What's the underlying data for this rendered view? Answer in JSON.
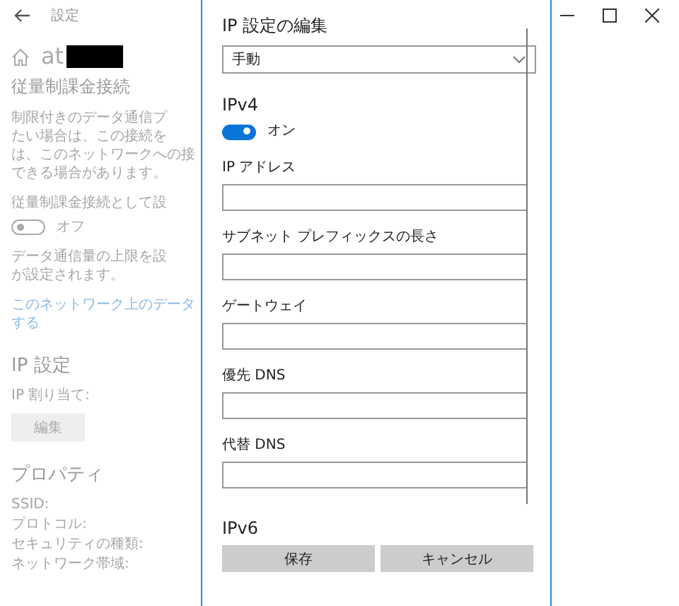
{
  "window": {
    "title": "設定"
  },
  "settings_page": {
    "network_name": "at",
    "heading": "従量制課金接続",
    "description": [
      "制限付きのデータ通信プ",
      "たい場合は、この接続を",
      "は、このネットワークへの接",
      "できる場合があります。"
    ],
    "metered_label": "従量制課金接続として設",
    "metered_toggle": {
      "on": false,
      "label": "オフ"
    },
    "data_limit_text": [
      "データ通信量の上限を設",
      "が設定されます。"
    ],
    "link": [
      "このネットワーク上のデータ",
      "する"
    ],
    "ip_section": {
      "title": "IP 設定",
      "assignment_label": "IP 割り当て:",
      "edit_button": "編集"
    },
    "properties": {
      "title": "プロパティ",
      "items": [
        "SSID:",
        "プロトコル:",
        "セキュリティの種類:",
        "ネットワーク帯域:"
      ]
    }
  },
  "dialog": {
    "title": "IP 設定の編集",
    "mode": "手動",
    "ipv4": {
      "title": "IPv4",
      "toggle": {
        "on": true,
        "label": "オン"
      }
    },
    "fields": [
      {
        "label": "IP アドレス"
      },
      {
        "label": "サブネット プレフィックスの長さ"
      },
      {
        "label": "ゲートウェイ"
      },
      {
        "label": "優先 DNS"
      },
      {
        "label": "代替 DNS"
      }
    ],
    "ipv6_title": "IPv6",
    "buttons": [
      "保存",
      "キャンセル"
    ]
  }
}
